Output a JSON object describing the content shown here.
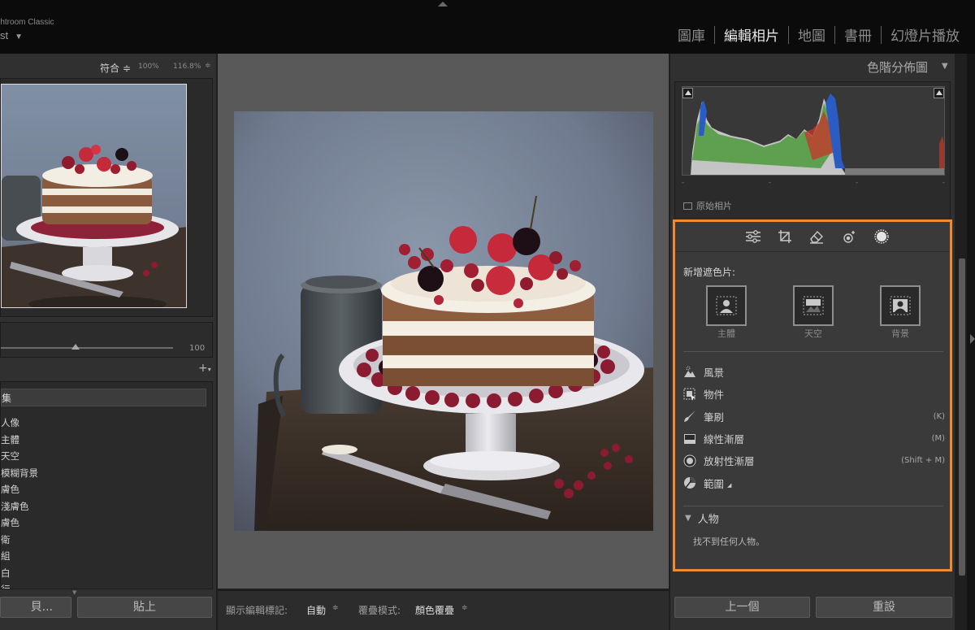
{
  "app": {
    "name": "Lightroom Classic",
    "catalog": "st"
  },
  "modules": [
    "圖庫",
    "編輯相片",
    "地圖",
    "書冊",
    "幻燈片播放"
  ],
  "navigator": {
    "fit_label": "符合 ≑",
    "zoom_100": "100%",
    "zoom_current": "116.8%",
    "zoom_caret": "≑"
  },
  "left_slider": {
    "value_label": "100",
    "level": 0.42
  },
  "collections": {
    "search_value": "集",
    "items": [
      "人像",
      "主體",
      "天空",
      "模糊背景",
      "膚色",
      "淺膚色",
      "膚色",
      "衛",
      "組",
      "白",
      "行"
    ]
  },
  "left_buttons": {
    "copy": "貝...",
    "paste": "貼上"
  },
  "toolbar": {
    "show_edit_label": "顯示編輯標記:",
    "show_edit_value": "自動",
    "overlay_label": "覆疊模式:",
    "overlay_value": "顏色覆疊"
  },
  "histogram": {
    "title": "色階分佈圖",
    "ticks": [
      "-",
      "-",
      "-",
      "-"
    ],
    "original_label": "原始相片"
  },
  "mask_panel": {
    "add_mask_label": "新增遮色片:",
    "big_buttons": [
      {
        "label": "主體",
        "icon": "subject-icon"
      },
      {
        "label": "天空",
        "icon": "sky-icon"
      },
      {
        "label": "背景",
        "icon": "background-icon"
      }
    ],
    "tools": [
      {
        "label": "風景",
        "icon": "landscape-icon",
        "shortcut": ""
      },
      {
        "label": "物件",
        "icon": "object-icon",
        "shortcut": ""
      },
      {
        "label": "筆刷",
        "icon": "brush-icon",
        "shortcut": "(K)"
      },
      {
        "label": "線性漸層",
        "icon": "linear-gradient-icon",
        "shortcut": "(M)"
      },
      {
        "label": "放射性漸層",
        "icon": "radial-gradient-icon",
        "shortcut": "(Shift + M)"
      },
      {
        "label": "範圍",
        "icon": "range-icon",
        "shortcut": ""
      }
    ],
    "people_heading": "人物",
    "people_message": "找不到任何人物。"
  },
  "right_buttons": {
    "previous": "上一個",
    "reset": "重設"
  },
  "colors": {
    "highlight": "#f08a2e",
    "histogram_blue": "#2a5cc4",
    "histogram_green": "#4c9a3c",
    "histogram_red": "#c23a2a"
  }
}
